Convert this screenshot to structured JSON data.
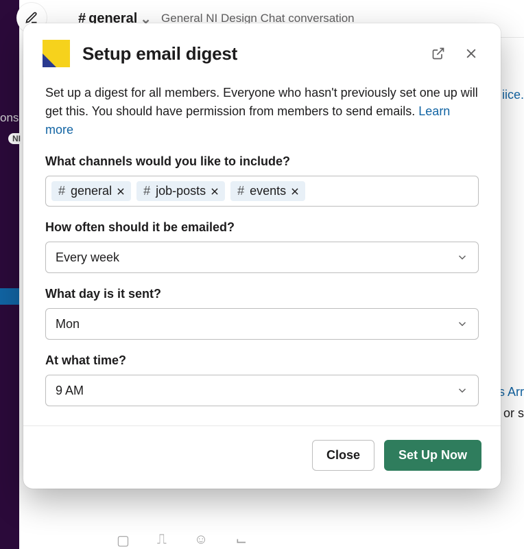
{
  "background": {
    "channel_name": "general",
    "chevron": "⌄",
    "topic": "General NI Design Chat conversation",
    "iice_fragment": "iice.",
    "arr_fragment": "s Arr",
    "ors_fragment": "or s",
    "ons_fragment": "ons",
    "pill": "NI"
  },
  "modal": {
    "title": "Setup email digest",
    "description_part1": "Set up a digest for all members. Everyone who hasn't previously set one up will get this. You should have permission from members to send emails. ",
    "learn_more": "Learn more",
    "channels_label": "What channels would you like to include?",
    "channels": [
      {
        "name": "general"
      },
      {
        "name": "job-posts"
      },
      {
        "name": "events"
      }
    ],
    "frequency_label": "How often should it be emailed?",
    "frequency_value": "Every week",
    "day_label": "What day is it sent?",
    "day_value": "Mon",
    "time_label": "At what time?",
    "time_value": "9 AM",
    "close_label": "Close",
    "primary_label": "Set Up Now"
  }
}
